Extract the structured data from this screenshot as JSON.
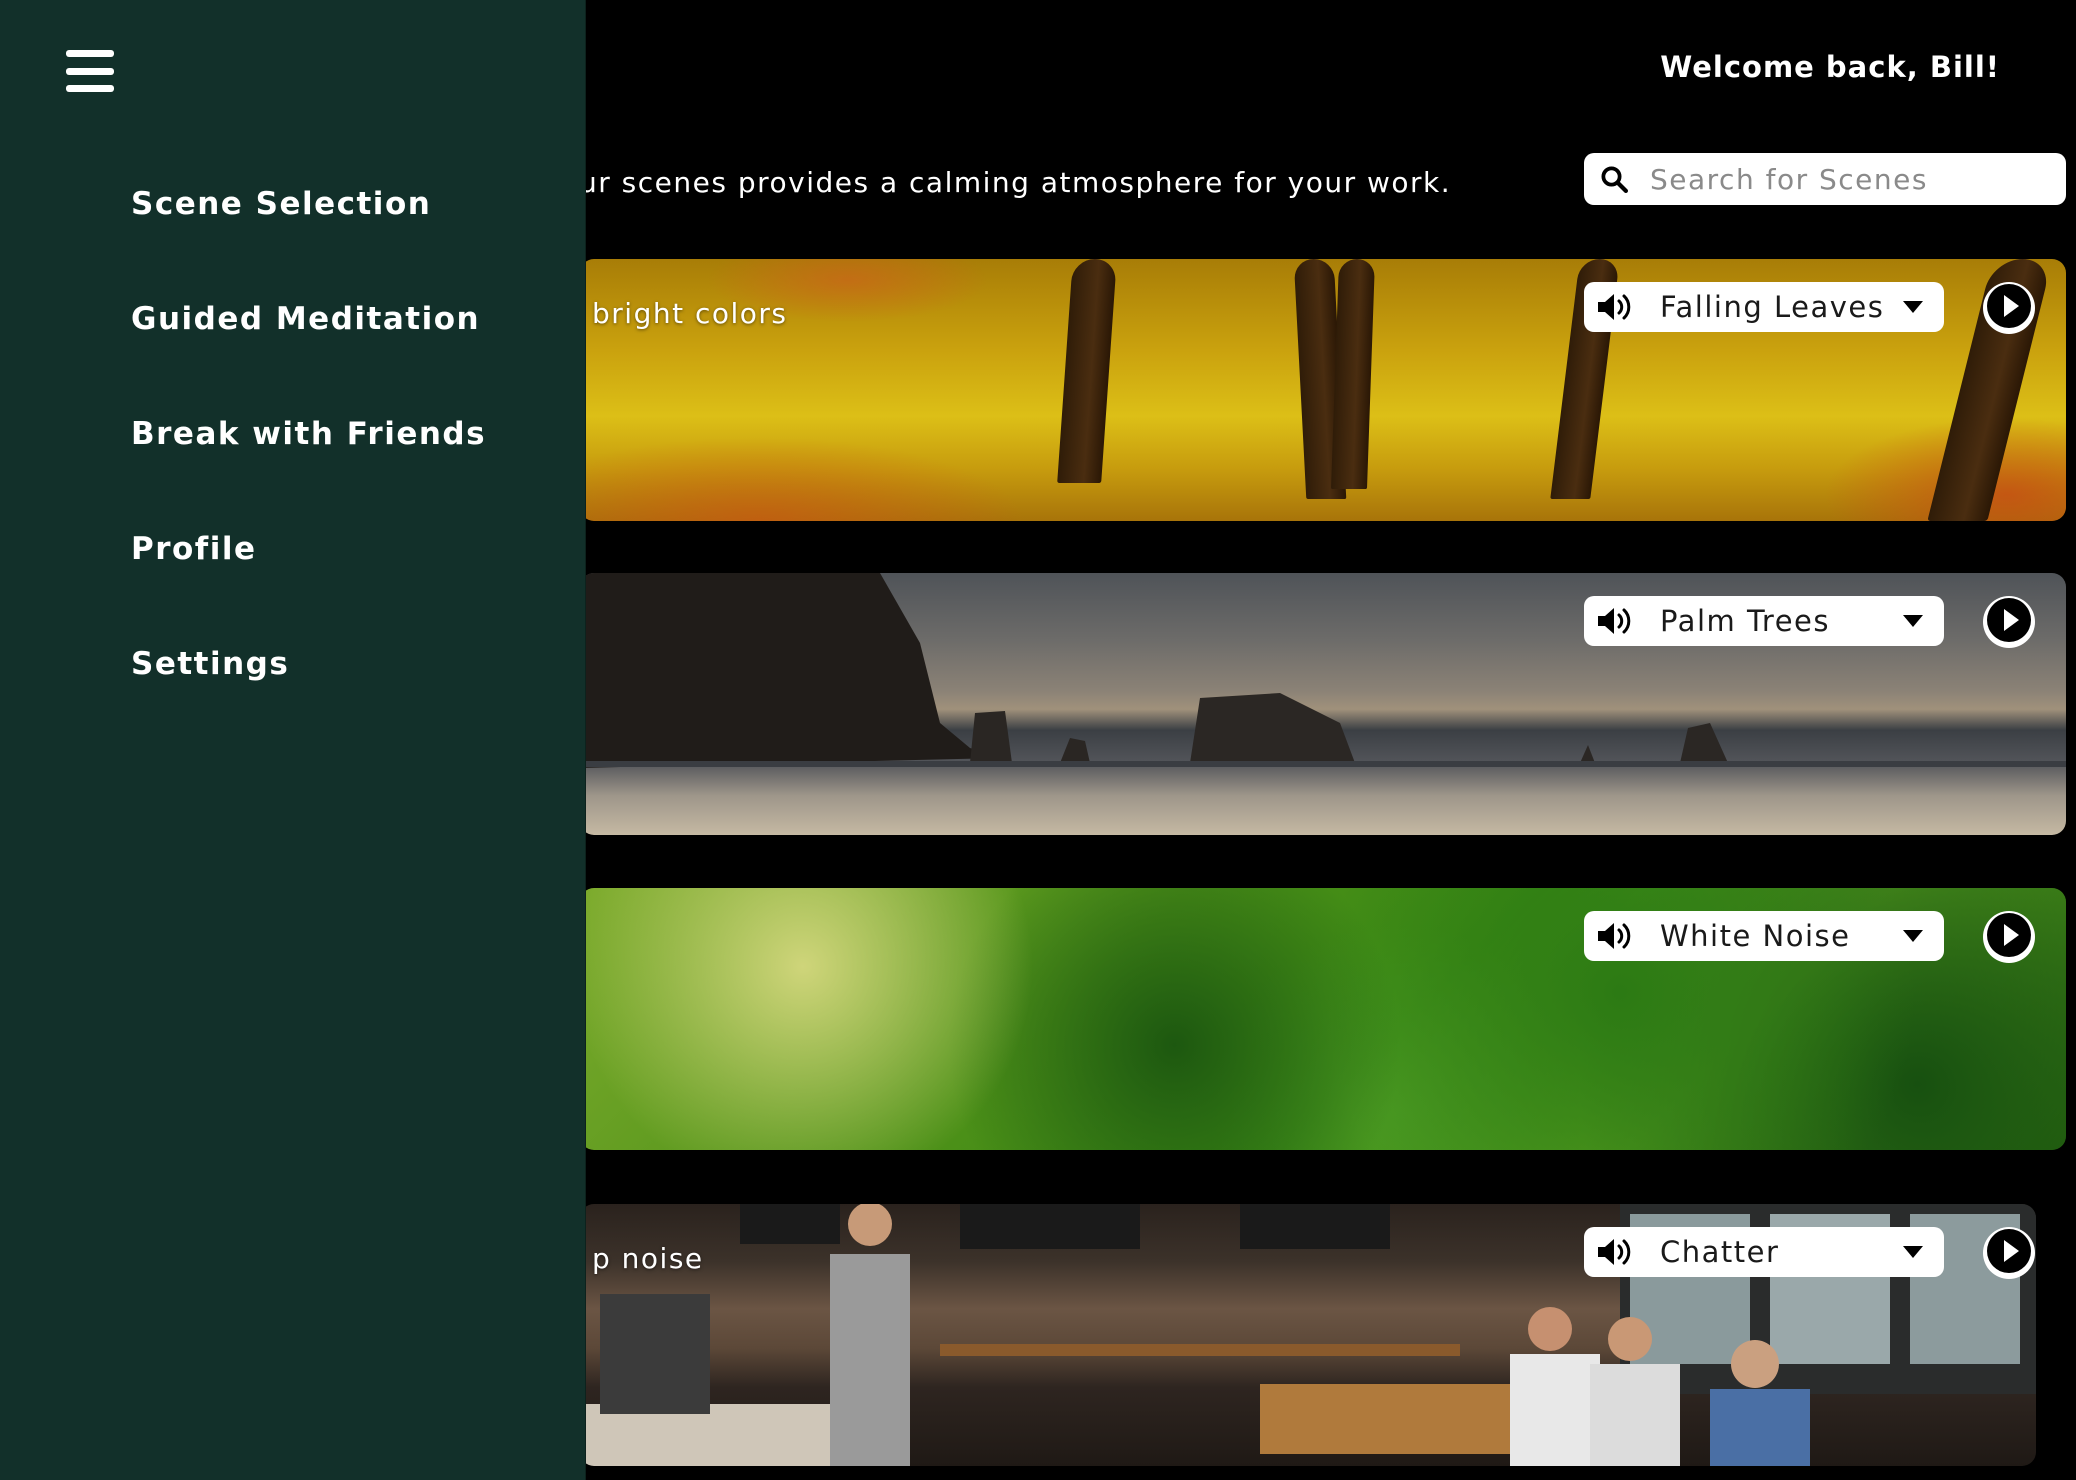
{
  "header": {
    "welcome": "Welcome back, Bill!",
    "tagline": "ur scenes provides a calming atmosphere for your work."
  },
  "search": {
    "placeholder": "Search for Scenes",
    "value": ""
  },
  "sidebar": {
    "items": [
      {
        "label": "Scene Selection"
      },
      {
        "label": "Guided Meditation"
      },
      {
        "label": "Break with Friends"
      },
      {
        "label": "Profile"
      },
      {
        "label": "Settings"
      }
    ]
  },
  "scenes": [
    {
      "description": "bright colors",
      "sound": "Falling Leaves"
    },
    {
      "description": "",
      "sound": "Palm Trees"
    },
    {
      "description": "",
      "sound": "White Noise"
    },
    {
      "description": "p noise",
      "sound": "Chatter"
    }
  ],
  "icons": {
    "menu": "hamburger-icon",
    "search": "search-icon",
    "volume": "speaker-icon",
    "dropdown": "caret-down-icon",
    "play": "play-icon"
  },
  "colors": {
    "sidebar_bg": "#12302a",
    "page_bg": "#000000",
    "control_bg": "#ffffff"
  }
}
